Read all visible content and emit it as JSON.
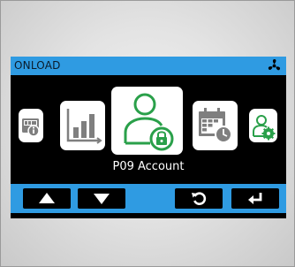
{
  "header": {
    "title": "ONLOAD",
    "status_icon": "fan-icon"
  },
  "menu": {
    "selected_label": "P09 Account",
    "items": [
      {
        "icon": "info-panel-icon"
      },
      {
        "icon": "bar-chart-icon"
      },
      {
        "icon": "user-lock-icon",
        "selected": true
      },
      {
        "icon": "calendar-clock-icon"
      },
      {
        "icon": "user-settings-icon"
      }
    ]
  },
  "buttons": [
    {
      "icon": "arrow-up-icon"
    },
    {
      "icon": "arrow-down-icon"
    },
    {
      "icon": "refresh-icon"
    },
    {
      "icon": "enter-icon"
    }
  ],
  "colors": {
    "accent_blue": "#2f9be2",
    "icon_green": "#2aa04a",
    "icon_gray": "#7f7f7f",
    "screen_black": "#000000"
  }
}
